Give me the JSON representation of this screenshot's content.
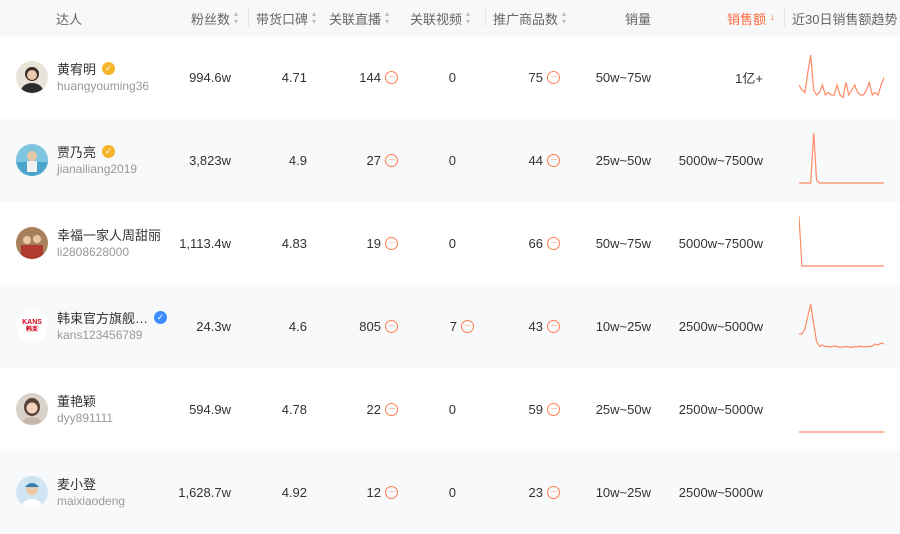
{
  "header": {
    "columns": [
      {
        "key": "creator",
        "label": "达人",
        "sortable": false
      },
      {
        "key": "fans",
        "label": "粉丝数",
        "sortable": true
      },
      {
        "key": "reputation",
        "label": "带货口碑",
        "sortable": true
      },
      {
        "key": "live",
        "label": "关联直播",
        "sortable": true
      },
      {
        "key": "video",
        "label": "关联视频",
        "sortable": true
      },
      {
        "key": "products",
        "label": "推广商品数",
        "sortable": true
      },
      {
        "key": "volume",
        "label": "销量",
        "sortable": false
      },
      {
        "key": "sales",
        "label": "销售额",
        "sortable": true,
        "active": true
      },
      {
        "key": "trend",
        "label": "近30日销售额趋势",
        "sortable": false
      }
    ],
    "sort_icon": "sort-up-down-icon",
    "sort_active_icon": "sort-down-icon"
  },
  "colors": {
    "accent": "#ff6a3d",
    "badge_gold": "#f7b52c",
    "badge_blue": "#3d8bff",
    "spark": "#ff8a65",
    "row_alt": "#f8f9fb"
  },
  "more_icon": "more-dots-icon",
  "rows": [
    {
      "name": "黄宥明",
      "uid": "huangyouming36",
      "badge": "gold",
      "fans": "994.6w",
      "reputation": "4.71",
      "live": "144",
      "video": "0",
      "products": "75",
      "volume": "50w~75w",
      "sales": "1亿+",
      "trend": [
        0.3,
        0.2,
        0.15,
        0.55,
        0.9,
        0.2,
        0.1,
        0.15,
        0.3,
        0.1,
        0.15,
        0.1,
        0.1,
        0.3,
        0.1,
        0.05,
        0.35,
        0.1,
        0.2,
        0.3,
        0.15,
        0.1,
        0.1,
        0.2,
        0.35,
        0.1,
        0.15,
        0.1,
        0.3,
        0.45
      ]
    },
    {
      "name": "贾乃亮",
      "uid": "jianailiang2019",
      "badge": "gold",
      "fans": "3,823w",
      "reputation": "4.9",
      "live": "27",
      "video": "0",
      "products": "44",
      "volume": "25w~50w",
      "sales": "5000w~7500w",
      "trend": [
        0,
        0,
        0,
        0,
        0,
        1,
        0.05,
        0,
        0,
        0,
        0,
        0,
        0,
        0,
        0,
        0,
        0,
        0,
        0,
        0,
        0,
        0,
        0,
        0,
        0,
        0,
        0,
        0,
        0,
        0
      ]
    },
    {
      "name": "幸福一家人周甜丽",
      "uid": "li2808628000",
      "badge": "",
      "fans": "1,113.4w",
      "reputation": "4.83",
      "live": "19",
      "video": "0",
      "products": "66",
      "volume": "50w~75w",
      "sales": "5000w~7500w",
      "trend": [
        1,
        0,
        0,
        0,
        0,
        0,
        0,
        0,
        0,
        0,
        0,
        0,
        0,
        0,
        0,
        0,
        0,
        0,
        0,
        0,
        0,
        0,
        0,
        0,
        0,
        0,
        0,
        0,
        0,
        0
      ]
    },
    {
      "name": "韩束官方旗舰…",
      "uid": "kans123456789",
      "badge": "blue",
      "fans": "24.3w",
      "reputation": "4.6",
      "live": "805",
      "video": "7",
      "products": "43",
      "volume": "10w~25w",
      "sales": "2500w~5000w",
      "trend": [
        0.3,
        0.3,
        0.4,
        0.65,
        0.9,
        0.5,
        0.15,
        0.05,
        0.08,
        0.05,
        0.05,
        0.04,
        0.06,
        0.05,
        0.03,
        0.04,
        0.05,
        0.04,
        0.03,
        0.05,
        0.04,
        0.06,
        0.04,
        0.05,
        0.05,
        0.06,
        0.1,
        0.08,
        0.12,
        0.1
      ]
    },
    {
      "name": "董艳颖",
      "uid": "dyy891111",
      "badge": "",
      "fans": "594.9w",
      "reputation": "4.78",
      "live": "22",
      "video": "0",
      "products": "59",
      "volume": "25w~50w",
      "sales": "2500w~5000w",
      "trend": [
        0,
        0,
        0,
        0,
        0,
        0,
        0,
        0,
        0,
        0,
        0,
        0,
        0,
        0,
        0,
        0,
        0,
        0,
        0,
        0,
        0,
        0,
        0,
        0,
        0,
        0,
        0,
        0,
        0,
        0
      ]
    },
    {
      "name": "麦小登",
      "uid": "maixiaodeng",
      "badge": "",
      "fans": "1,628.7w",
      "reputation": "4.92",
      "live": "12",
      "video": "0",
      "products": "23",
      "volume": "10w~25w",
      "sales": "2500w~5000w",
      "trend": []
    }
  ],
  "kans_logo": {
    "line1": "KANS",
    "line2": "韩束"
  }
}
